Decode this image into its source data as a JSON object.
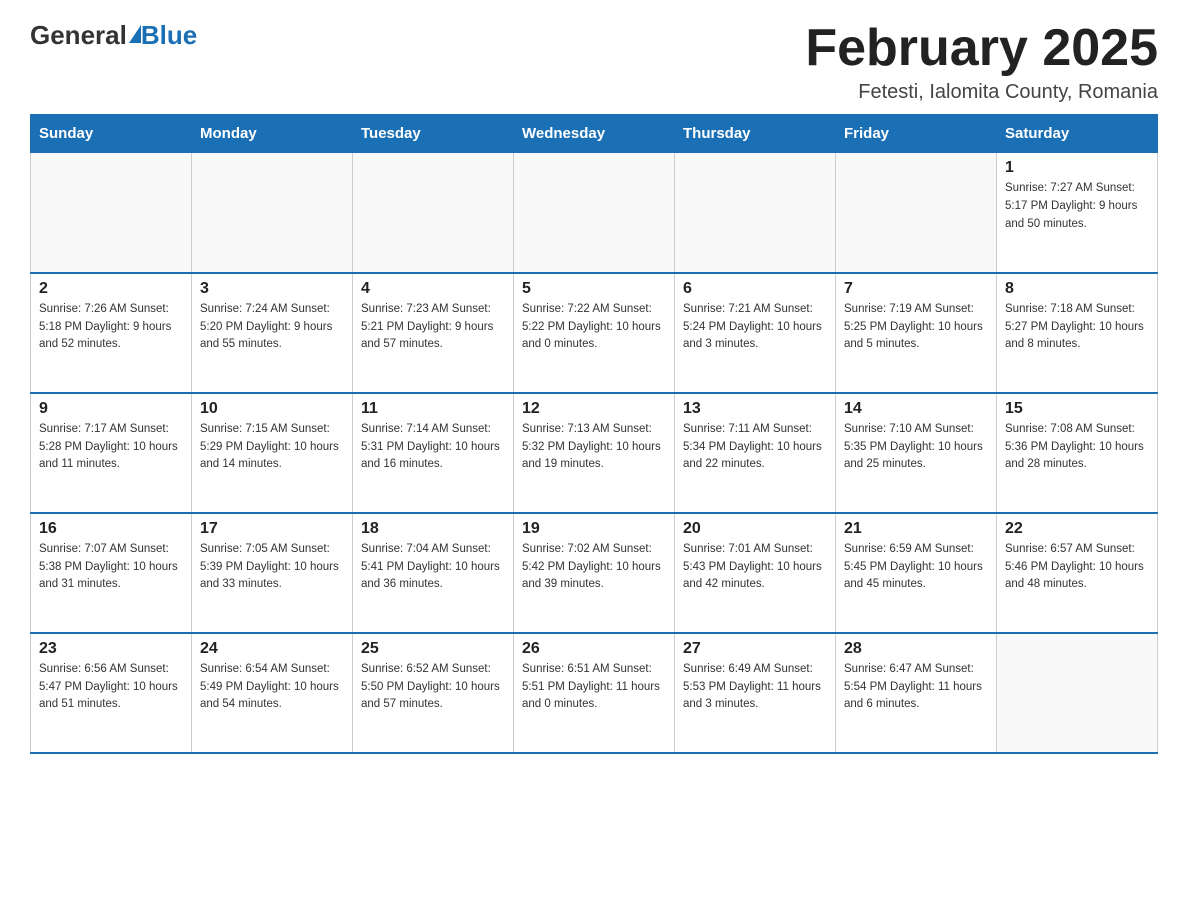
{
  "header": {
    "logo_general": "General",
    "logo_blue": "Blue",
    "month_title": "February 2025",
    "subtitle": "Fetesti, Ialomita County, Romania"
  },
  "days_of_week": [
    "Sunday",
    "Monday",
    "Tuesday",
    "Wednesday",
    "Thursday",
    "Friday",
    "Saturday"
  ],
  "weeks": [
    [
      {
        "day": "",
        "info": ""
      },
      {
        "day": "",
        "info": ""
      },
      {
        "day": "",
        "info": ""
      },
      {
        "day": "",
        "info": ""
      },
      {
        "day": "",
        "info": ""
      },
      {
        "day": "",
        "info": ""
      },
      {
        "day": "1",
        "info": "Sunrise: 7:27 AM\nSunset: 5:17 PM\nDaylight: 9 hours and 50 minutes."
      }
    ],
    [
      {
        "day": "2",
        "info": "Sunrise: 7:26 AM\nSunset: 5:18 PM\nDaylight: 9 hours and 52 minutes."
      },
      {
        "day": "3",
        "info": "Sunrise: 7:24 AM\nSunset: 5:20 PM\nDaylight: 9 hours and 55 minutes."
      },
      {
        "day": "4",
        "info": "Sunrise: 7:23 AM\nSunset: 5:21 PM\nDaylight: 9 hours and 57 minutes."
      },
      {
        "day": "5",
        "info": "Sunrise: 7:22 AM\nSunset: 5:22 PM\nDaylight: 10 hours and 0 minutes."
      },
      {
        "day": "6",
        "info": "Sunrise: 7:21 AM\nSunset: 5:24 PM\nDaylight: 10 hours and 3 minutes."
      },
      {
        "day": "7",
        "info": "Sunrise: 7:19 AM\nSunset: 5:25 PM\nDaylight: 10 hours and 5 minutes."
      },
      {
        "day": "8",
        "info": "Sunrise: 7:18 AM\nSunset: 5:27 PM\nDaylight: 10 hours and 8 minutes."
      }
    ],
    [
      {
        "day": "9",
        "info": "Sunrise: 7:17 AM\nSunset: 5:28 PM\nDaylight: 10 hours and 11 minutes."
      },
      {
        "day": "10",
        "info": "Sunrise: 7:15 AM\nSunset: 5:29 PM\nDaylight: 10 hours and 14 minutes."
      },
      {
        "day": "11",
        "info": "Sunrise: 7:14 AM\nSunset: 5:31 PM\nDaylight: 10 hours and 16 minutes."
      },
      {
        "day": "12",
        "info": "Sunrise: 7:13 AM\nSunset: 5:32 PM\nDaylight: 10 hours and 19 minutes."
      },
      {
        "day": "13",
        "info": "Sunrise: 7:11 AM\nSunset: 5:34 PM\nDaylight: 10 hours and 22 minutes."
      },
      {
        "day": "14",
        "info": "Sunrise: 7:10 AM\nSunset: 5:35 PM\nDaylight: 10 hours and 25 minutes."
      },
      {
        "day": "15",
        "info": "Sunrise: 7:08 AM\nSunset: 5:36 PM\nDaylight: 10 hours and 28 minutes."
      }
    ],
    [
      {
        "day": "16",
        "info": "Sunrise: 7:07 AM\nSunset: 5:38 PM\nDaylight: 10 hours and 31 minutes."
      },
      {
        "day": "17",
        "info": "Sunrise: 7:05 AM\nSunset: 5:39 PM\nDaylight: 10 hours and 33 minutes."
      },
      {
        "day": "18",
        "info": "Sunrise: 7:04 AM\nSunset: 5:41 PM\nDaylight: 10 hours and 36 minutes."
      },
      {
        "day": "19",
        "info": "Sunrise: 7:02 AM\nSunset: 5:42 PM\nDaylight: 10 hours and 39 minutes."
      },
      {
        "day": "20",
        "info": "Sunrise: 7:01 AM\nSunset: 5:43 PM\nDaylight: 10 hours and 42 minutes."
      },
      {
        "day": "21",
        "info": "Sunrise: 6:59 AM\nSunset: 5:45 PM\nDaylight: 10 hours and 45 minutes."
      },
      {
        "day": "22",
        "info": "Sunrise: 6:57 AM\nSunset: 5:46 PM\nDaylight: 10 hours and 48 minutes."
      }
    ],
    [
      {
        "day": "23",
        "info": "Sunrise: 6:56 AM\nSunset: 5:47 PM\nDaylight: 10 hours and 51 minutes."
      },
      {
        "day": "24",
        "info": "Sunrise: 6:54 AM\nSunset: 5:49 PM\nDaylight: 10 hours and 54 minutes."
      },
      {
        "day": "25",
        "info": "Sunrise: 6:52 AM\nSunset: 5:50 PM\nDaylight: 10 hours and 57 minutes."
      },
      {
        "day": "26",
        "info": "Sunrise: 6:51 AM\nSunset: 5:51 PM\nDaylight: 11 hours and 0 minutes."
      },
      {
        "day": "27",
        "info": "Sunrise: 6:49 AM\nSunset: 5:53 PM\nDaylight: 11 hours and 3 minutes."
      },
      {
        "day": "28",
        "info": "Sunrise: 6:47 AM\nSunset: 5:54 PM\nDaylight: 11 hours and 6 minutes."
      },
      {
        "day": "",
        "info": ""
      }
    ]
  ]
}
